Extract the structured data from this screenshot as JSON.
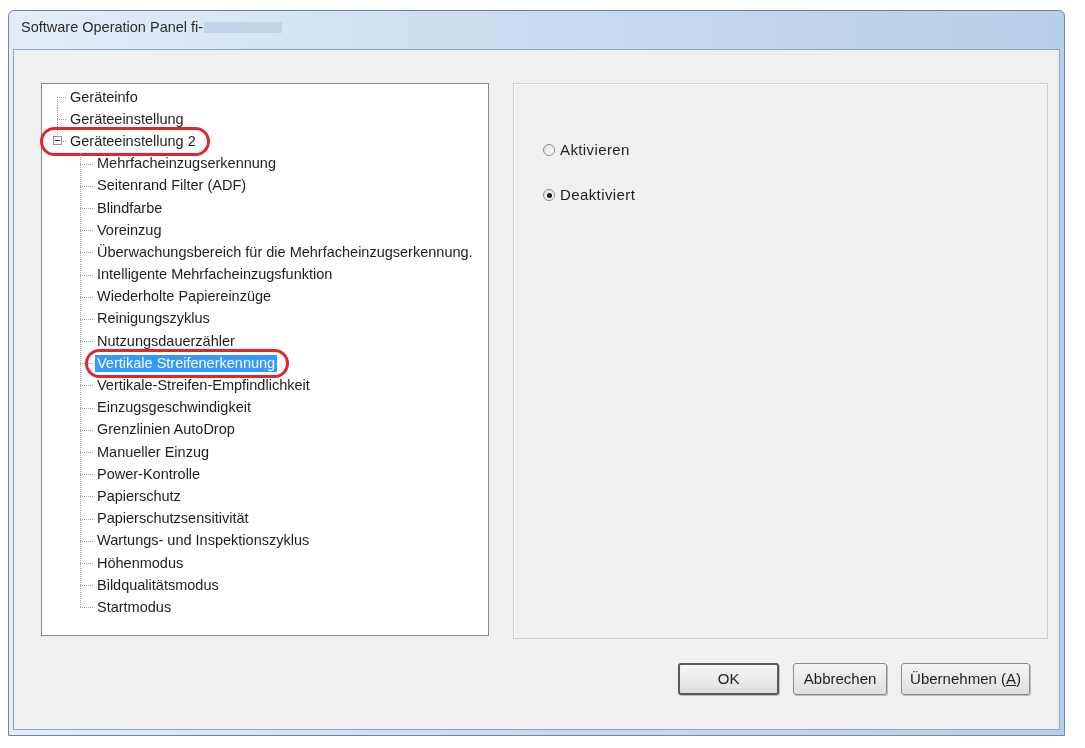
{
  "window": {
    "title": "Software Operation Panel fi-"
  },
  "tree": {
    "items": [
      {
        "label": "Geräteinfo",
        "selected": false,
        "circled": false
      },
      {
        "label": "Geräteeinstellung",
        "selected": false,
        "circled": false
      },
      {
        "label": "Geräteeinstellung 2",
        "selected": false,
        "circled": true,
        "expanded": true,
        "children": [
          {
            "label": "Mehrfacheinzugserkennung",
            "selected": false,
            "circled": false
          },
          {
            "label": "Seitenrand Filter (ADF)",
            "selected": false,
            "circled": false
          },
          {
            "label": "Blindfarbe",
            "selected": false,
            "circled": false
          },
          {
            "label": "Voreinzug",
            "selected": false,
            "circled": false
          },
          {
            "label": "Überwachungsbereich für die Mehrfacheinzugserkennung.",
            "selected": false,
            "circled": false
          },
          {
            "label": "Intelligente Mehrfacheinzugsfunktion",
            "selected": false,
            "circled": false
          },
          {
            "label": "Wiederholte Papiereinzüge",
            "selected": false,
            "circled": false
          },
          {
            "label": "Reinigungszyklus",
            "selected": false,
            "circled": false
          },
          {
            "label": "Nutzungsdauerzähler",
            "selected": false,
            "circled": false
          },
          {
            "label": "Vertikale Streifenerkennung",
            "selected": true,
            "circled": true
          },
          {
            "label": "Vertikale-Streifen-Empfindlichkeit",
            "selected": false,
            "circled": false
          },
          {
            "label": "Einzugsgeschwindigkeit",
            "selected": false,
            "circled": false
          },
          {
            "label": "Grenzlinien AutoDrop",
            "selected": false,
            "circled": false
          },
          {
            "label": "Manueller Einzug",
            "selected": false,
            "circled": false
          },
          {
            "label": "Power-Kontrolle",
            "selected": false,
            "circled": false
          },
          {
            "label": "Papierschutz",
            "selected": false,
            "circled": false
          },
          {
            "label": "Papierschutzsensitivität",
            "selected": false,
            "circled": false
          },
          {
            "label": "Wartungs- und Inspektionszyklus",
            "selected": false,
            "circled": false
          },
          {
            "label": "Höhenmodus",
            "selected": false,
            "circled": false
          },
          {
            "label": "Bildqualitätsmodus",
            "selected": false,
            "circled": false
          },
          {
            "label": "Startmodus",
            "selected": false,
            "circled": false
          }
        ]
      }
    ]
  },
  "settings": {
    "options": [
      {
        "label": "Aktivieren",
        "selected": false
      },
      {
        "label": "Deaktiviert",
        "selected": true
      }
    ]
  },
  "buttons": [
    {
      "label": "OK",
      "default": true
    },
    {
      "label": "Abbrechen",
      "default": false
    },
    {
      "label": "Übernehmen (",
      "mnemonic": "A",
      "label_end": ")",
      "default": false
    }
  ]
}
